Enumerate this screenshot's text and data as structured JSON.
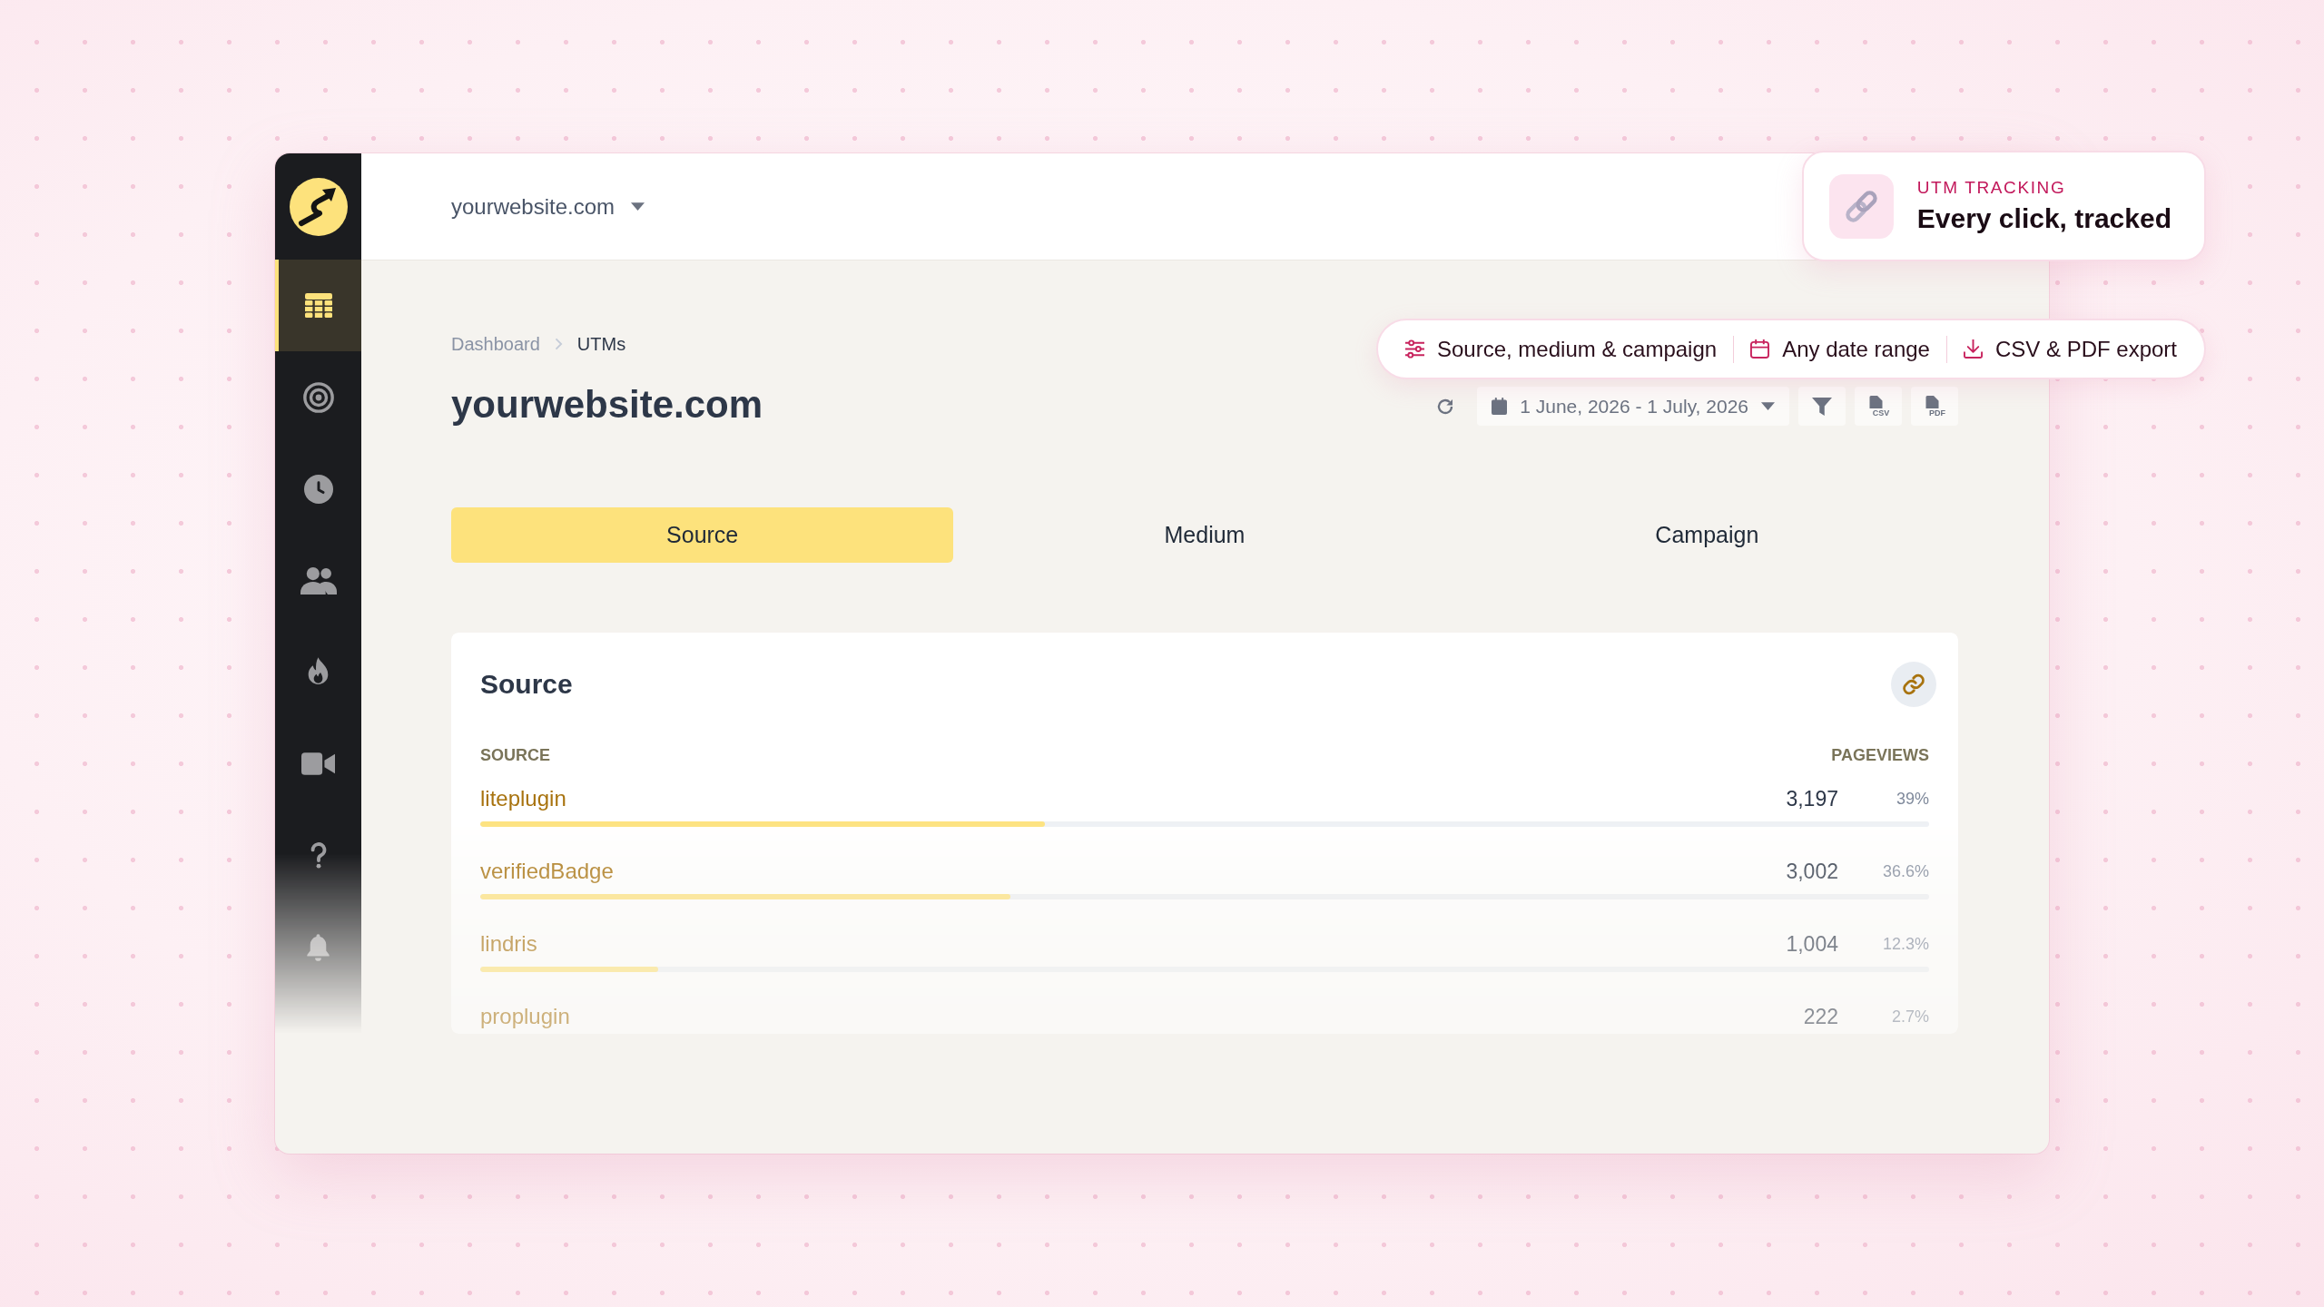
{
  "sidebar": {
    "items": [
      {
        "kind": "grid",
        "selected": true
      },
      {
        "kind": "target",
        "selected": false
      },
      {
        "kind": "clock",
        "selected": false
      },
      {
        "kind": "users",
        "selected": false
      },
      {
        "kind": "fire",
        "selected": false
      },
      {
        "kind": "video",
        "selected": false
      },
      {
        "kind": "help",
        "selected": false
      },
      {
        "kind": "bell",
        "selected": false
      }
    ]
  },
  "topbar": {
    "site_selector": "yourwebsite.com"
  },
  "breadcrumb": [
    "Dashboard",
    "UTMs"
  ],
  "title": "yourwebsite.com",
  "toolbar": {
    "date_range": "1 June, 2026 - 1 July, 2026",
    "buttons": [
      {
        "kind": "filter"
      },
      {
        "kind": "file",
        "label": "CSV"
      },
      {
        "kind": "file",
        "label": "PDF"
      }
    ]
  },
  "tabs": [
    {
      "label": "Source",
      "selected": true
    },
    {
      "label": "Medium",
      "selected": false
    },
    {
      "label": "Campaign",
      "selected": false
    }
  ],
  "card": {
    "title": "Source",
    "columns": [
      "SOURCE",
      "PAGEVIEWS"
    ],
    "rows": [
      {
        "name": "liteplugin",
        "pageviews": "3,197",
        "share": "39%",
        "level": 0.39
      },
      {
        "name": "verifiedBadge",
        "pageviews": "3,002",
        "share": "36.6%",
        "level": 0.366
      },
      {
        "name": "lindris",
        "pageviews": "1,004",
        "share": "12.3%",
        "level": 0.123
      },
      {
        "name": "proplugin",
        "pageviews": "222",
        "share": "2.7%"
      }
    ]
  },
  "callout": {
    "eyebrow": "UTM TRACKING",
    "headline": "Every click, tracked"
  },
  "features": [
    {
      "kind": "sliders",
      "label": "Source, medium & campaign"
    },
    {
      "kind": "calendar",
      "label": "Any date range"
    },
    {
      "kind": "download",
      "label": "CSV & PDF export"
    }
  ]
}
